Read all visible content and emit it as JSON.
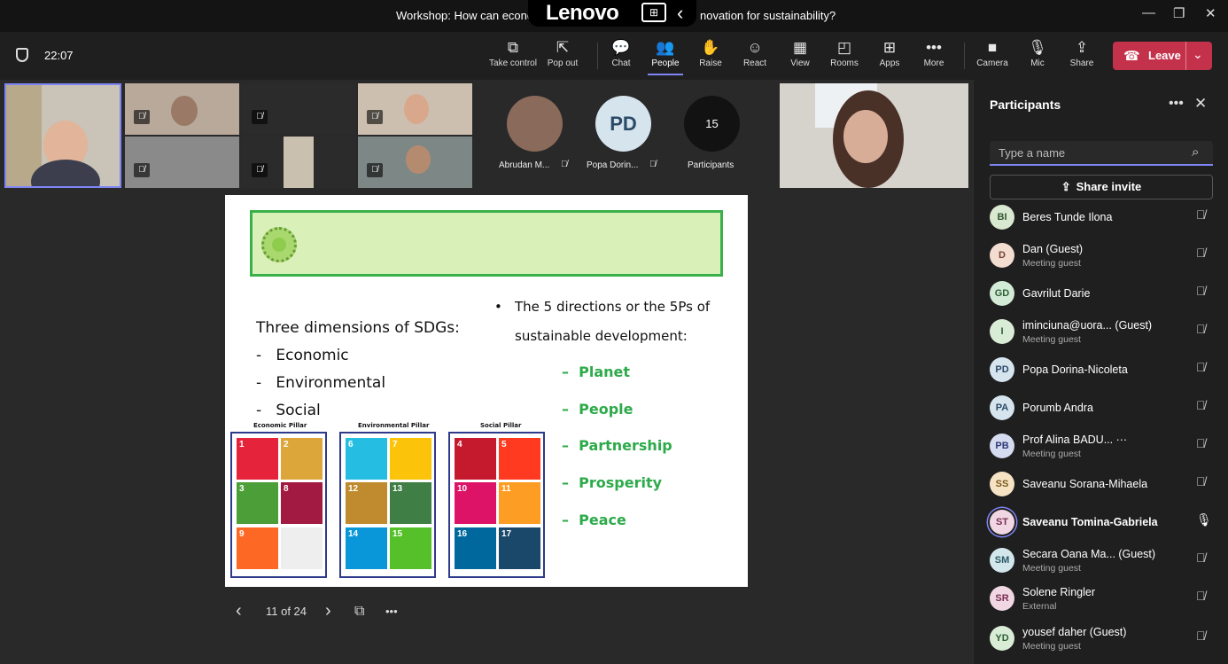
{
  "window": {
    "title_left": "Workshop: How can econo",
    "title_right": "novation for sustainability?",
    "brand": "Lenovo",
    "minimize": "—",
    "restore": "❐",
    "close": "✕"
  },
  "toolbar": {
    "time": "22:07",
    "buttons": [
      {
        "label": "Take control",
        "icon": "⧉"
      },
      {
        "label": "Pop out",
        "icon": "⇱"
      },
      {
        "label": "Chat",
        "icon": "💬"
      },
      {
        "label": "People",
        "icon": "👥"
      },
      {
        "label": "Raise",
        "icon": "✋"
      },
      {
        "label": "React",
        "icon": "☺"
      },
      {
        "label": "View",
        "icon": "▦"
      },
      {
        "label": "Rooms",
        "icon": "◰"
      },
      {
        "label": "Apps",
        "icon": "⊞"
      },
      {
        "label": "More",
        "icon": "•••"
      },
      {
        "label": "Camera",
        "icon": "■"
      },
      {
        "label": "Mic",
        "icon": "🎙"
      },
      {
        "label": "Share",
        "icon": "⇪"
      }
    ],
    "leave_label": "Leave",
    "leave_icon": "☎",
    "leave_chevron": "⌄"
  },
  "video": {
    "avatar_tiles": [
      {
        "initials": "",
        "name": "Abrudan M..."
      },
      {
        "initials": "PD",
        "name": "Popa Dorin..."
      },
      {
        "initials": "15",
        "name": "Participants"
      }
    ]
  },
  "slide": {
    "left_heading": "Three dimensions of SDGs:",
    "left_items": [
      "Economic",
      "Environmental",
      "Social"
    ],
    "bullet_1": "The 5 directions or the 5Ps of",
    "bullet_2": "sustainable development:",
    "five_ps": [
      "Planet",
      "People",
      "Partnership",
      "Prosperity",
      "Peace"
    ],
    "pillars": [
      {
        "title": "Economic Pillar",
        "goals": [
          {
            "num": "1",
            "color": "#e5243b"
          },
          {
            "num": "2",
            "color": "#dda63a"
          },
          {
            "num": "3",
            "color": "#4c9f38"
          },
          {
            "num": "8",
            "color": "#a21942"
          },
          {
            "num": "9",
            "color": "#fd6925"
          }
        ]
      },
      {
        "title": "Environmental Pillar",
        "goals": [
          {
            "num": "6",
            "color": "#26bde2"
          },
          {
            "num": "7",
            "color": "#fcc30b"
          },
          {
            "num": "12",
            "color": "#bf8b2e"
          },
          {
            "num": "13",
            "color": "#3f7e44"
          },
          {
            "num": "14",
            "color": "#0a97d9"
          },
          {
            "num": "15",
            "color": "#56c02b"
          }
        ]
      },
      {
        "title": "Social Pillar",
        "goals": [
          {
            "num": "4",
            "color": "#c5192d"
          },
          {
            "num": "5",
            "color": "#ff3a21"
          },
          {
            "num": "10",
            "color": "#dd1367"
          },
          {
            "num": "11",
            "color": "#fd9d24"
          },
          {
            "num": "16",
            "color": "#00689d"
          },
          {
            "num": "17",
            "color": "#19486a"
          }
        ]
      }
    ]
  },
  "slide_nav": {
    "page": "11 of 24",
    "prev": "‹",
    "next": "›",
    "grid": "⧉",
    "more": "•••"
  },
  "panel": {
    "title": "Participants",
    "more": "•••",
    "close": "✕",
    "search_placeholder": "Type a name",
    "invite_label": "Share invite",
    "participants": [
      {
        "initials": "BI",
        "name": "Beres Tunde Ilona",
        "sub": "",
        "color": "#d9e8d0",
        "text": "#335533",
        "mic": "off"
      },
      {
        "initials": "D",
        "name": "Dan (Guest)",
        "sub": "Meeting guest",
        "color": "#f3dcd0",
        "text": "#774433",
        "mic": "off"
      },
      {
        "initials": "GD",
        "name": "Gavrilut Darie",
        "sub": "",
        "color": "#d3ead6",
        "text": "#2f5e36",
        "mic": "off"
      },
      {
        "initials": "I",
        "name": "iminciuna@uora...   (Guest)",
        "sub": "Meeting guest",
        "color": "#d8ecd6",
        "text": "#2f5e36",
        "mic": "off"
      },
      {
        "initials": "PD",
        "name": "Popa Dorina-Nicoleta",
        "sub": "",
        "color": "#d6e4ee",
        "text": "#2b4a66",
        "mic": "off"
      },
      {
        "initials": "PA",
        "name": "Porumb Andra",
        "sub": "",
        "color": "#d6e4ee",
        "text": "#2b4a66",
        "mic": "off"
      },
      {
        "initials": "PB",
        "name": "Prof Alina BADU...  ···",
        "sub": "Meeting guest",
        "color": "#d6dcf0",
        "text": "#2d3a77",
        "mic": "off"
      },
      {
        "initials": "SS",
        "name": "Saveanu Sorana-Mihaela",
        "sub": "",
        "color": "#f6e3c4",
        "text": "#7a5a1e",
        "mic": "off"
      },
      {
        "initials": "ST",
        "name": "Saveanu Tomina-Gabriela",
        "sub": "",
        "color": "#f0d7e3",
        "text": "#7a2f55",
        "mic": "on"
      },
      {
        "initials": "SM",
        "name": "Secara Oana Ma...   (Guest)",
        "sub": "Meeting guest",
        "color": "#d3e6ec",
        "text": "#2b5a66",
        "mic": "off"
      },
      {
        "initials": "SR",
        "name": "Solene Ringler",
        "sub": "External",
        "color": "#f0d7e3",
        "text": "#7a2f55",
        "mic": "off"
      },
      {
        "initials": "YD",
        "name": "yousef daher (Guest)",
        "sub": "Meeting guest",
        "color": "#d8ecd6",
        "text": "#2f5e36",
        "mic": "off"
      }
    ]
  }
}
